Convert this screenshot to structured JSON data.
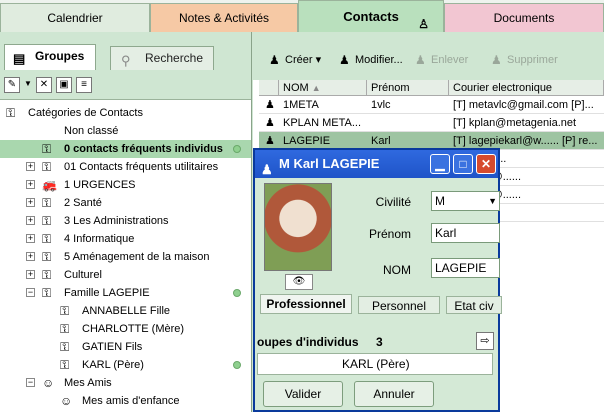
{
  "top_tabs": [
    {
      "label": "Calendrier"
    },
    {
      "label": "Notes & Activités"
    },
    {
      "label": "Contacts"
    },
    {
      "label": "Documents"
    }
  ],
  "left": {
    "tabs": {
      "groupes": "Groupes",
      "recherche": "Recherche"
    },
    "tree": [
      {
        "label": "Catégories de Contacts",
        "indent": 0,
        "expander": "",
        "icon": "key-icon"
      },
      {
        "label": "Non classé",
        "indent": 1,
        "expander": "",
        "icon": ""
      },
      {
        "label": "0 contacts fréquents individus",
        "indent": 1,
        "expander": "",
        "icon": "key-icon",
        "selected": true,
        "dot": true
      },
      {
        "label": "01 Contacts  fréquents utilitaires",
        "indent": 1,
        "expander": "+",
        "icon": "key-icon"
      },
      {
        "label": "1 URGENCES",
        "indent": 1,
        "expander": "+",
        "icon": "truck-icon"
      },
      {
        "label": "2 Santé",
        "indent": 1,
        "expander": "+",
        "icon": "key-icon"
      },
      {
        "label": "3  Les Administrations",
        "indent": 1,
        "expander": "+",
        "icon": "key-icon"
      },
      {
        "label": "4 Informatique",
        "indent": 1,
        "expander": "+",
        "icon": "key-icon"
      },
      {
        "label": "5 Aménagement de la maison",
        "indent": 1,
        "expander": "+",
        "icon": "key-icon"
      },
      {
        "label": "Culturel",
        "indent": 1,
        "expander": "+",
        "icon": "key-icon"
      },
      {
        "label": "Famille LAGEPIE",
        "indent": 1,
        "expander": "−",
        "icon": "key-icon",
        "dot": true
      },
      {
        "label": "ANNABELLE Fille",
        "indent": 2,
        "expander": "",
        "icon": "key-icon"
      },
      {
        "label": "CHARLOTTE (Mère)",
        "indent": 2,
        "expander": "",
        "icon": "key-icon"
      },
      {
        "label": "GATIEN Fils",
        "indent": 2,
        "expander": "",
        "icon": "key-icon"
      },
      {
        "label": "KARL  (Père)",
        "indent": 2,
        "expander": "",
        "icon": "key-icon",
        "dot": true
      },
      {
        "label": "Mes Amis",
        "indent": 1,
        "expander": "−",
        "icon": "smiley-icon"
      },
      {
        "label": "Mes amis d'enfance",
        "indent": 2,
        "expander": "",
        "icon": "smiley-icon"
      }
    ]
  },
  "right": {
    "toolbar": {
      "create": "Créer",
      "modify": "Modifier...",
      "remove": "Enlever",
      "delete": "Supprimer"
    },
    "columns": [
      "NOM",
      "Prénom",
      "Courier electronique"
    ],
    "rows": [
      {
        "nom": "1META",
        "prenom": "1vlc",
        "email": "[T] metavlc@gmail.com  [P]..."
      },
      {
        "nom": "KPLAN META...",
        "prenom": "",
        "email": "[T] kplan@metagenia.net"
      },
      {
        "nom": "LAGEPIE",
        "prenom": "Karl",
        "email": "[T] lagepiekarl@w...... [P] re...",
        "selected": true
      },
      {
        "nom": "",
        "prenom": "",
        "email": "ecor@l......"
      },
      {
        "nom": "",
        "prenom": "",
        "email": "etitcube@......"
      },
      {
        "nom": "",
        "prenom": "",
        "email": "etitcube@......"
      },
      {
        "nom": "",
        "prenom": "",
        "email": "@......"
      }
    ]
  },
  "dialog": {
    "title": "M Karl LAGEPIE",
    "civilite_label": "Civilité",
    "civilite_value": "M",
    "prenom_label": "Prénom",
    "prenom_value": "Karl",
    "nom_label": "NOM",
    "nom_value": "LAGEPIE",
    "tabs": [
      "Professionnel",
      "Personnel",
      "Etat civ"
    ],
    "group_label": "oupes d'individus",
    "group_count": "3",
    "group_item": "KARL  (Père)",
    "ok": "Valider",
    "cancel": "Annuler"
  },
  "colors": {
    "accent": "#2f69df",
    "panel": "#cfe6d2",
    "selected_row": "#9ec4a2"
  }
}
